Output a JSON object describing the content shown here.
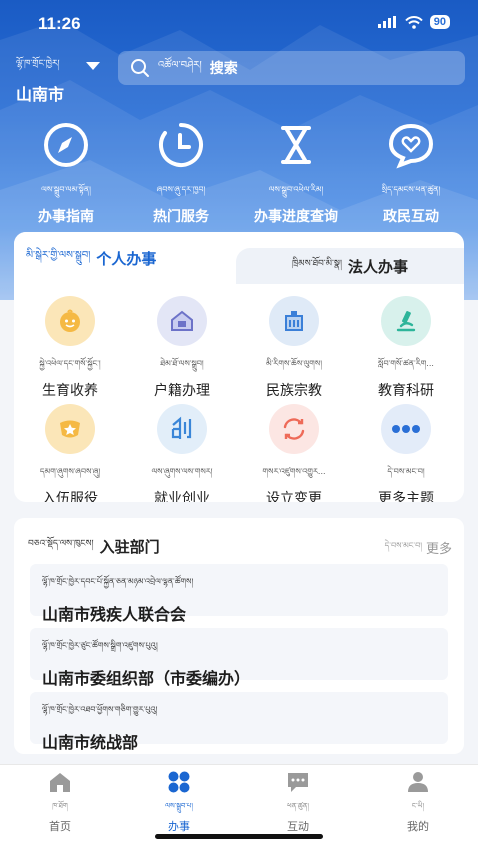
{
  "status": {
    "time": "11:26",
    "battery": "90"
  },
  "header": {
    "city_tib": "ལྷོ་ཁ་གྲོང་ཁྱེར།",
    "city": "山南市",
    "search_tib": "འཚོལ་བཤེར།",
    "search_label": "搜索"
  },
  "quick_links": [
    {
      "tib": "ལས་སྒྲུབ་ལམ་སྟོན།",
      "label": "办事指南",
      "icon": "compass-icon"
    },
    {
      "tib": "ཞབས་ཞུ་དར་ཁྱབ།",
      "label": "热门服务",
      "icon": "clock-icon"
    },
    {
      "tib": "ལས་སྒྲུབ་འཕེལ་རིམ།",
      "label": "办事进度查询",
      "icon": "hourglass-icon"
    },
    {
      "tib": "སྲིད་དམངས་ཕན་ཚུན།",
      "label": "政民互动",
      "icon": "chat-heart-icon"
    }
  ],
  "services": {
    "tab_personal_tib": "མི་སྒེར་གྱི་ལས་སྒྲུབ།",
    "tab_personal": "个人办事",
    "tab_legal_tib": "ཁྲིམས་ཐོབ་མི་སྣ།",
    "tab_legal": "法人办事",
    "items": [
      {
        "tib": "སྐྱེ་འཕེལ་དང་གསོ་སྐྱོང་།",
        "label": "生育收养",
        "icon": "baby-icon",
        "color": "#fbe6b8"
      },
      {
        "tib": "ཐེམ་ཐོ་ལས་སྒྲུབ།",
        "label": "户籍办理",
        "icon": "house-icon",
        "color": "#e3e6f6"
      },
      {
        "tib": "མི་རིགས་ཆོས་ལུགས།",
        "label": "民族宗教",
        "icon": "building-icon",
        "color": "#dfeaf7"
      },
      {
        "tib": "སློབ་གསོ་ཚན་རིག...",
        "label": "教育科研",
        "icon": "microscope-icon",
        "color": "#d8f1ec"
      },
      {
        "tib": "དམག་ཞུགས་ཞབས་ཞུ།",
        "label": "入伍服役",
        "icon": "badge-icon",
        "color": "#fbe6b8"
      },
      {
        "tib": "ལས་ཞུགས་ལས་གསར།",
        "label": "就业创业",
        "icon": "create-icon",
        "color": "#e2eef9"
      },
      {
        "tib": "གསར་འཛུགས་འགྱུར...",
        "label": "设立变更",
        "icon": "refresh-icon",
        "color": "#fce6e3"
      },
      {
        "tib": "དེ་བས་མང་བ།",
        "label": "更多主题",
        "icon": "more-icon",
        "color": "#e3ecf9"
      }
    ]
  },
  "departments": {
    "title_tib": "བཅའ་སྡོད་ལས་ཁུངས།",
    "title": "入驻部门",
    "more_tib": "དེ་བས་མང་བ།",
    "more": "更多",
    "items": [
      {
        "tib": "ལྷོ་ཁ་གྲོང་ཁྱེར་དབང་པོ་སྐྱོན་ཅན་མཉམ་འབྲེལ་ལྷན་ཚོགས།",
        "label": "山南市残疾人联合会"
      },
      {
        "tib": "ལྷོ་ཁ་གྲོང་ཁྱེར་ཙུང་ཚོགས་སྒྲིག་འཛུགས་པུའུ།",
        "label": "山南市委组织部（市委编办）"
      },
      {
        "tib": "ལྷོ་ཁ་གྲོང་ཁྱེར་འཐབ་ཕྱོགས་གཅིག་གྱུར་པུའུ།",
        "label": "山南市统战部"
      }
    ]
  },
  "tabbar": [
    {
      "tib": "ཁ་ཐོག",
      "label": "首页",
      "icon": "home-icon"
    },
    {
      "tib": "ལས་སྒྲུབ་པ།",
      "label": "办事",
      "icon": "grid-icon"
    },
    {
      "tib": "ཕན་ཚུན།",
      "label": "互动",
      "icon": "message-icon"
    },
    {
      "tib": "ང་ཡི།",
      "label": "我的",
      "icon": "person-icon"
    }
  ]
}
